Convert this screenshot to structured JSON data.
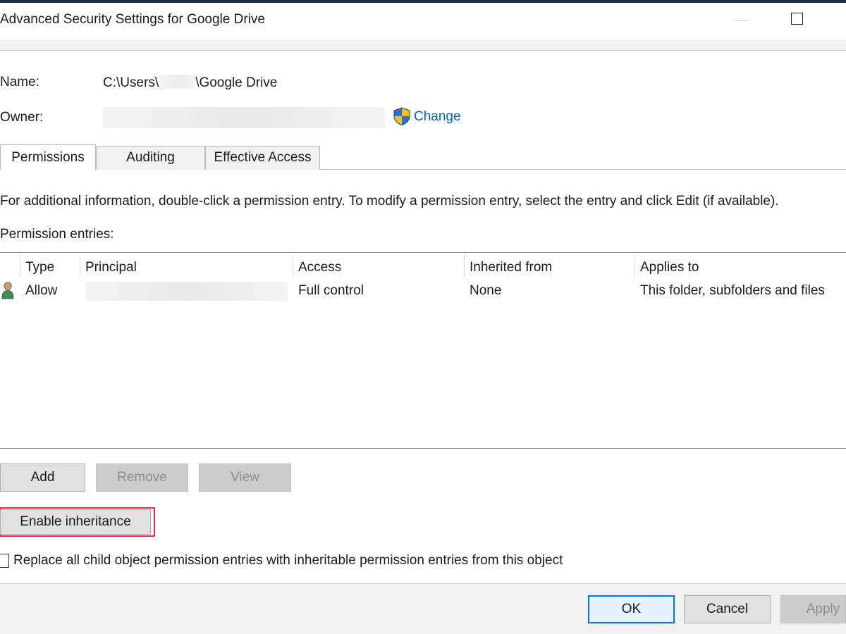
{
  "window": {
    "title": "Advanced Security Settings for Google Drive"
  },
  "name_field": {
    "label": "Name:",
    "path_prefix": "C:\\Users\\",
    "path_suffix": "\\Google Drive"
  },
  "owner_field": {
    "label": "Owner:",
    "change_link": "Change",
    "icon": "uac-shield-icon"
  },
  "tabs": [
    {
      "label": "Permissions",
      "active": true
    },
    {
      "label": "Auditing",
      "active": false
    },
    {
      "label": "Effective Access",
      "active": false
    }
  ],
  "info_text": "For additional information, double-click a permission entry. To modify a permission entry, select the entry and click Edit (if available).",
  "entries_label": "Permission entries:",
  "table": {
    "columns": [
      "Type",
      "Principal",
      "Access",
      "Inherited from",
      "Applies to"
    ],
    "rows": [
      {
        "type": "Allow",
        "principal": "",
        "access": "Full control",
        "inherited_from": "None",
        "applies_to": "This folder, subfolders and files",
        "icon": "user-icon"
      }
    ]
  },
  "entry_buttons": {
    "add": "Add",
    "remove": "Remove",
    "view": "View"
  },
  "enable_inheritance": "Enable inheritance",
  "replace_checkbox": {
    "label": "Replace all child object permission entries with inheritable permission entries from this object",
    "checked": false
  },
  "footer_buttons": {
    "ok": "OK",
    "cancel": "Cancel",
    "apply": "Apply"
  },
  "colors": {
    "link": "#0066cc",
    "highlight_border": "#e32b39",
    "ok_border": "#0078d7"
  }
}
